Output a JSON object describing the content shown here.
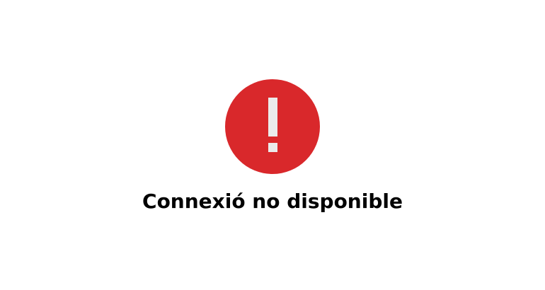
{
  "error": {
    "icon": "exclamation-circle-icon",
    "icon_color": "#d9282b",
    "message": "Connexió no disponible"
  }
}
